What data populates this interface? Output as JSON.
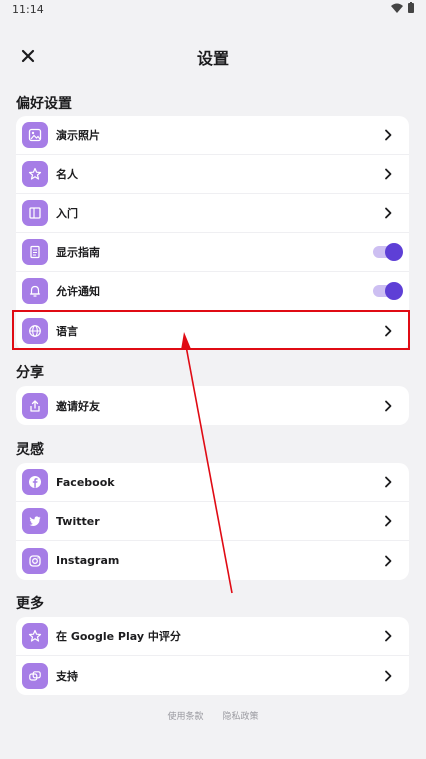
{
  "status": {
    "time": "11:14"
  },
  "header": {
    "title": "设置"
  },
  "sections": {
    "preferences": {
      "title": "偏好设置",
      "items": [
        {
          "label": "演示照片",
          "icon": "photo-icon",
          "control": "chevron"
        },
        {
          "label": "名人",
          "icon": "star-icon",
          "control": "chevron"
        },
        {
          "label": "入门",
          "icon": "door-icon",
          "control": "chevron"
        },
        {
          "label": "显示指南",
          "icon": "guide-icon",
          "control": "toggle",
          "on": true
        },
        {
          "label": "允许通知",
          "icon": "bell-icon",
          "control": "toggle",
          "on": true
        },
        {
          "label": "语言",
          "icon": "globe-icon",
          "control": "chevron"
        }
      ]
    },
    "share": {
      "title": "分享",
      "items": [
        {
          "label": "邀请好友",
          "icon": "share-icon",
          "control": "chevron"
        }
      ]
    },
    "inspiration": {
      "title": "灵感",
      "items": [
        {
          "label": "Facebook",
          "icon": "facebook-icon",
          "control": "chevron"
        },
        {
          "label": "Twitter",
          "icon": "twitter-icon",
          "control": "chevron"
        },
        {
          "label": "Instagram",
          "icon": "instagram-icon",
          "control": "chevron"
        }
      ]
    },
    "more": {
      "title": "更多",
      "items": [
        {
          "label": "在 Google Play 中评分",
          "icon": "star-icon",
          "control": "chevron"
        },
        {
          "label": "支持",
          "icon": "support-icon",
          "control": "chevron"
        }
      ]
    }
  },
  "footer": {
    "terms": "使用条款",
    "privacy": "隐私政策"
  },
  "colors": {
    "accent": "#a67de6",
    "toggle": "#5e3fd6",
    "annotation": "#e00b14"
  }
}
